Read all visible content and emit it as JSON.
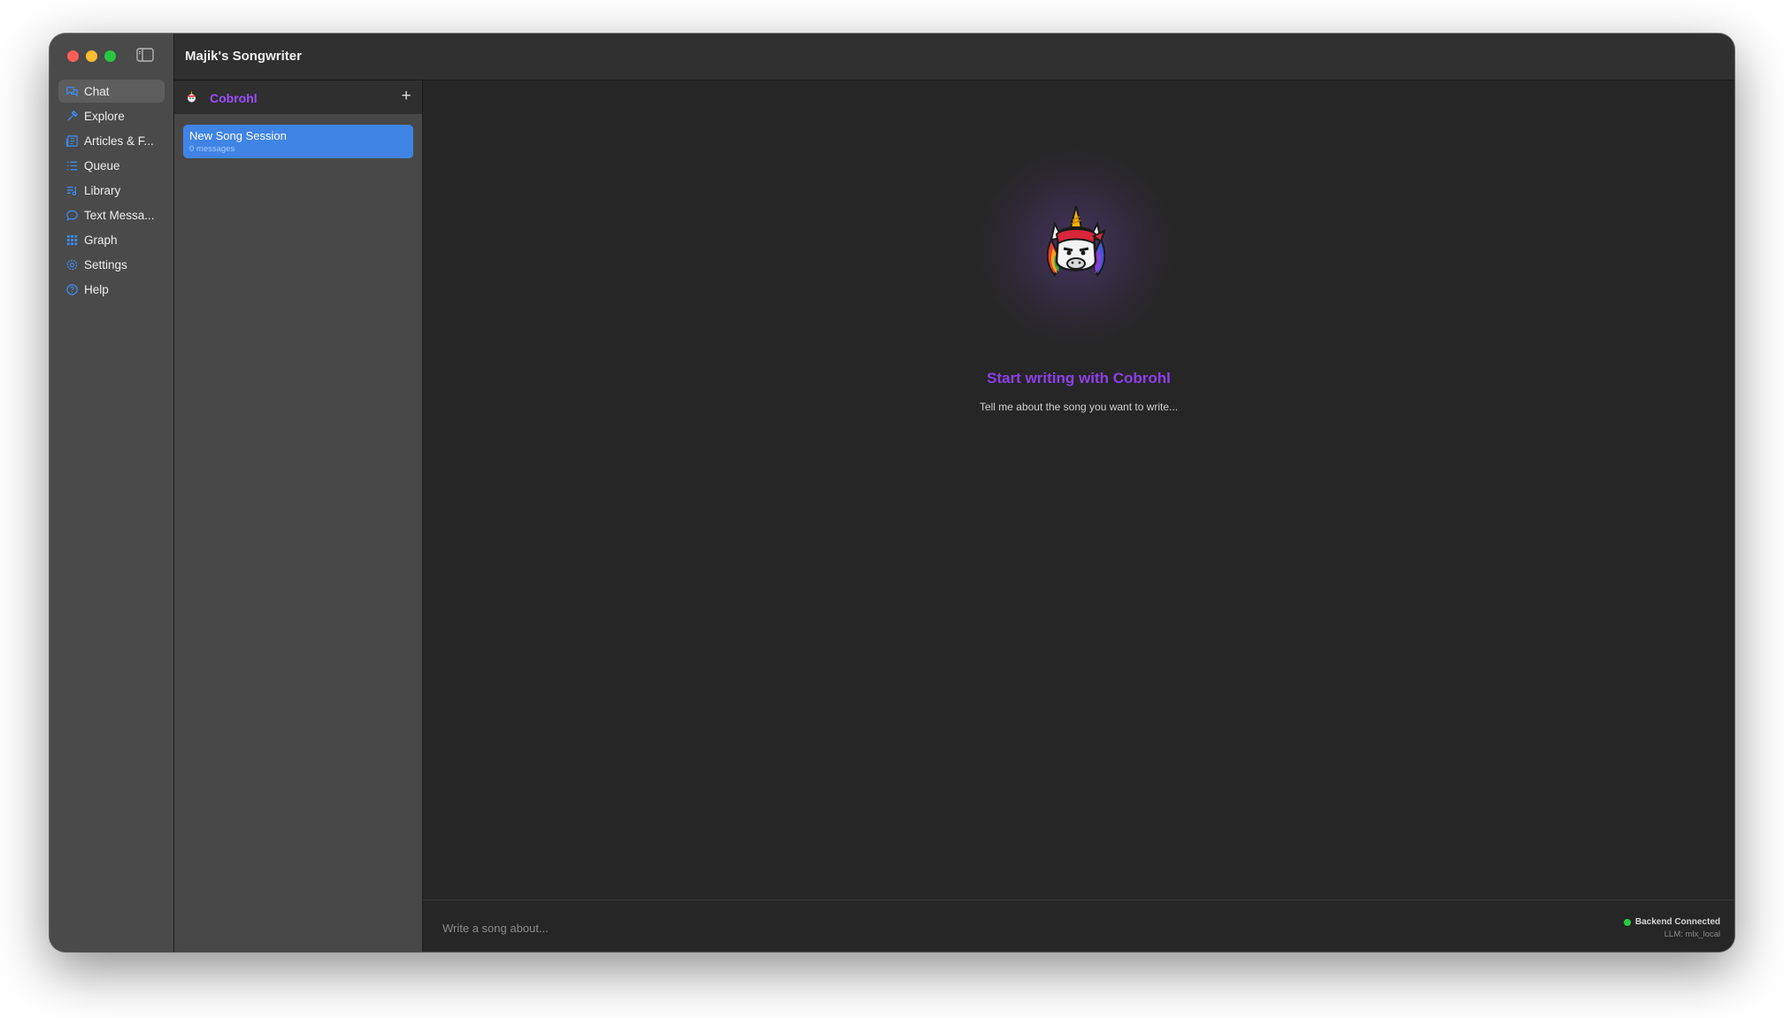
{
  "app": {
    "title": "Majik's Songwriter"
  },
  "sidebar": {
    "items": [
      {
        "label": "Chat",
        "icon": "chat-icon",
        "active": true
      },
      {
        "label": "Explore",
        "icon": "explore-icon"
      },
      {
        "label": "Articles & F...",
        "icon": "articles-icon"
      },
      {
        "label": "Queue",
        "icon": "queue-icon"
      },
      {
        "label": "Library",
        "icon": "library-icon"
      },
      {
        "label": "Text Messa...",
        "icon": "text-message-icon"
      },
      {
        "label": "Graph",
        "icon": "graph-icon"
      },
      {
        "label": "Settings",
        "icon": "settings-icon"
      },
      {
        "label": "Help",
        "icon": "help-icon"
      }
    ]
  },
  "sessions": {
    "persona_name": "Cobrohl",
    "add_label": "+",
    "items": [
      {
        "title": "New Song Session",
        "subtitle": "0 messages"
      }
    ]
  },
  "main": {
    "title": "Start writing with Cobrohl",
    "subtitle": "Tell me about the song you want to write..."
  },
  "composer": {
    "placeholder": "Write a song about..."
  },
  "status": {
    "label": "Backend Connected",
    "llm": "LLM: mlx_local"
  },
  "colors": {
    "accent": "#8e3fe8",
    "selection": "#3f84e5",
    "icon_blue": "#3f8ef0",
    "status_ok": "#28c840"
  }
}
